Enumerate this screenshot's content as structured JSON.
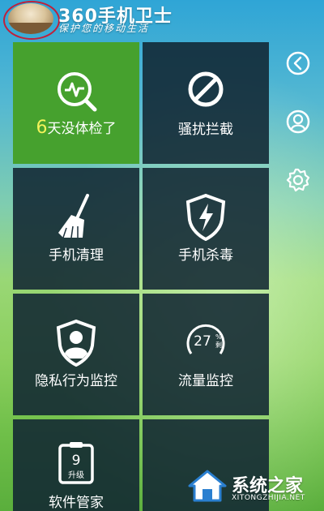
{
  "header": {
    "brand": "360手机卫士",
    "slogan": "保护您的移动生活"
  },
  "tiles": [
    {
      "prefix": "6",
      "label": "天没体检了",
      "icon": "health-check-icon"
    },
    {
      "label": "骚扰拦截",
      "icon": "block-icon"
    },
    {
      "label": "手机清理",
      "icon": "broom-icon"
    },
    {
      "label": "手机杀毒",
      "icon": "shield-lightning-icon"
    },
    {
      "label": "隐私行为监控",
      "icon": "privacy-shield-icon"
    },
    {
      "gauge_value": "27",
      "gauge_unit": "%",
      "gauge_sub": "剩",
      "label": "流量监控",
      "icon": "traffic-gauge-icon"
    },
    {
      "badge_number": "9",
      "badge_text": "升级",
      "label": "软件管家",
      "icon": "app-manager-icon"
    },
    {
      "label": "",
      "icon": ""
    }
  ],
  "sidebar": [
    "back-icon",
    "user-icon",
    "settings-icon"
  ],
  "watermark": {
    "title": "系统之家",
    "url": "XITONGZHIJIA.NET"
  },
  "colors": {
    "accent_green": "#46a12e",
    "tile_dark": "#112632",
    "highlight": "#f3f35a"
  }
}
